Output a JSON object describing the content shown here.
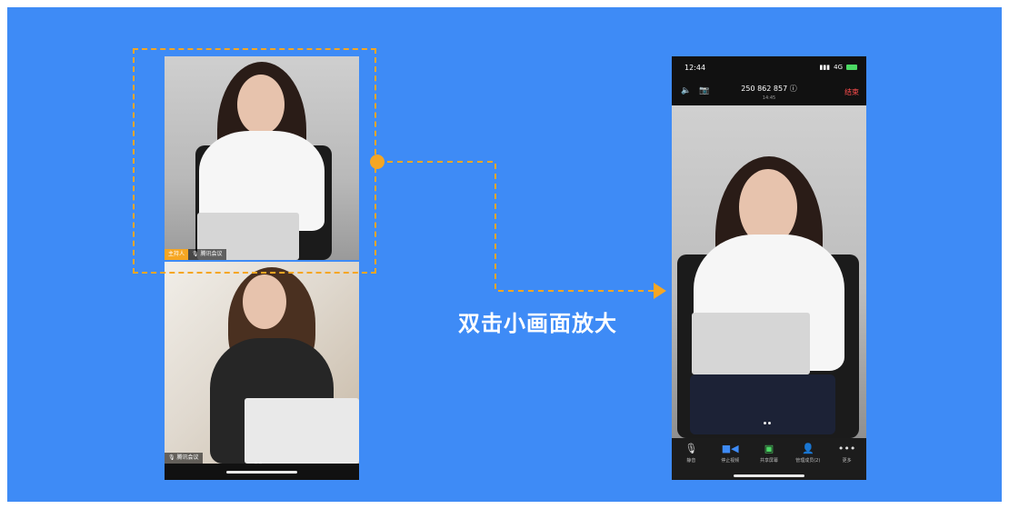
{
  "caption": "双击小画面放大",
  "left_tiles": {
    "top_host_tag": "主持人",
    "top_mic_tag": "腾讯会议",
    "bottom_mic_tag": "腾讯会议"
  },
  "right_phone": {
    "status_time": "12:44",
    "network": "4G",
    "meeting_id": "250 862 857",
    "meeting_subtitle": "14:45",
    "end_label": "结束",
    "toolbar": [
      {
        "label": "静音",
        "icon": "mic-icon"
      },
      {
        "label": "停止视频",
        "icon": "video-icon"
      },
      {
        "label": "共享屏幕",
        "icon": "share-screen-icon"
      },
      {
        "label": "管理成员(2)",
        "icon": "members-icon"
      },
      {
        "label": "更多",
        "icon": "more-icon"
      }
    ]
  },
  "colors": {
    "background": "#3e8bf6",
    "accent": "#f5a623",
    "end": "#ff4d4d"
  }
}
